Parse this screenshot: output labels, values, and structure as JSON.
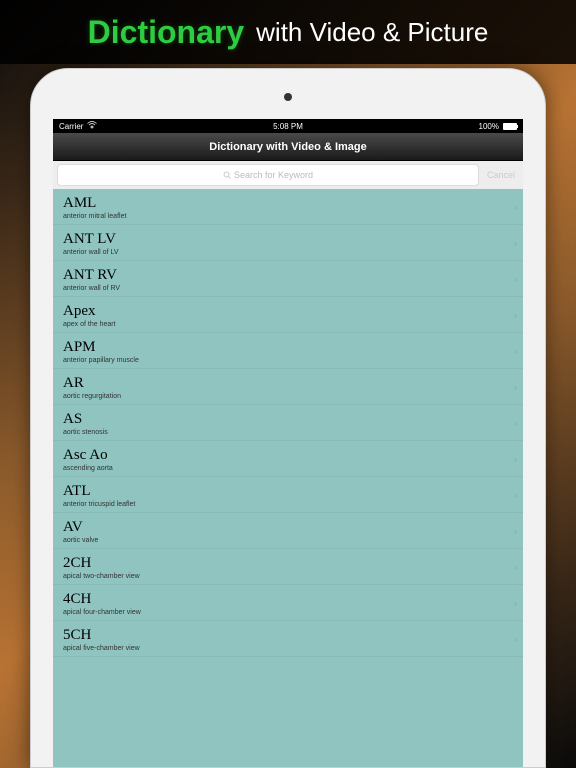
{
  "promo": {
    "green": "Dictionary",
    "white": "with Video & Picture"
  },
  "status": {
    "carrier": "Carrier",
    "time": "5:08 PM",
    "battery": "100%"
  },
  "nav": {
    "title": "Dictionary with Video & Image"
  },
  "search": {
    "placeholder": "Search for Keyword",
    "cancel": "Cancel"
  },
  "items": [
    {
      "term": "AML",
      "def": "anterior mitral leaflet"
    },
    {
      "term": "ANT LV",
      "def": "anterior wall of LV"
    },
    {
      "term": "ANT RV",
      "def": "anterior wall of RV"
    },
    {
      "term": "Apex",
      "def": "apex of the heart"
    },
    {
      "term": "APM",
      "def": "anterior papillary muscle"
    },
    {
      "term": "AR",
      "def": "aortic regurgitation"
    },
    {
      "term": "AS",
      "def": "aortic stenosis"
    },
    {
      "term": "Asc Ao",
      "def": "ascending aorta"
    },
    {
      "term": "ATL",
      "def": "anterior tricuspid leaflet"
    },
    {
      "term": "AV",
      "def": "aortic valve"
    },
    {
      "term": "2CH",
      "def": "apical two-chamber view"
    },
    {
      "term": "4CH",
      "def": "apical four-chamber view"
    },
    {
      "term": "5CH",
      "def": "apical five-chamber view"
    }
  ]
}
